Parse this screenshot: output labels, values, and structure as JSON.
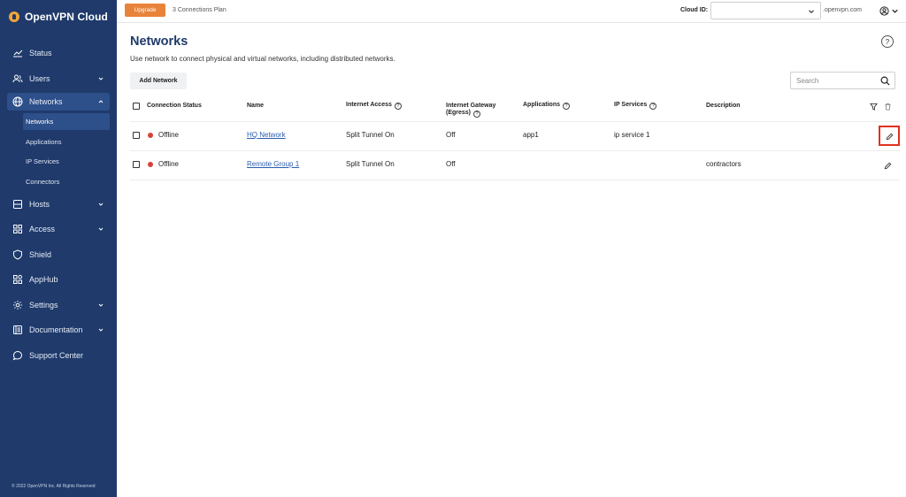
{
  "app": {
    "title": "OpenVPN Cloud",
    "copyright": "© 2022 OpenVPN Inc. All Rights Reserved"
  },
  "topbar": {
    "upgrade_label": "Upgrade",
    "plan_text": "3 Connections Plan",
    "cloud_id_label": "Cloud ID:",
    "cloud_id_value": "",
    "domain_suffix": ".openvpn.com"
  },
  "sidebar": {
    "items": [
      {
        "label": "Status",
        "icon": "chart-line-icon"
      },
      {
        "label": "Users",
        "icon": "users-icon"
      },
      {
        "label": "Networks",
        "icon": "globe-icon"
      },
      {
        "label": "Hosts",
        "icon": "server-icon"
      },
      {
        "label": "Access",
        "icon": "grid-icon"
      },
      {
        "label": "Shield",
        "icon": "shield-icon"
      },
      {
        "label": "AppHub",
        "icon": "apphub-icon"
      },
      {
        "label": "Settings",
        "icon": "gear-icon"
      },
      {
        "label": "Documentation",
        "icon": "book-icon"
      },
      {
        "label": "Support Center",
        "icon": "chat-icon"
      }
    ],
    "network_subitems": [
      "Networks",
      "Applications",
      "IP Services",
      "Connectors"
    ]
  },
  "main": {
    "title": "Networks",
    "description": "Use network to connect physical and virtual networks, including distributed networks.",
    "add_button": "Add Network",
    "search_placeholder": "Search"
  },
  "table": {
    "headers": {
      "status": "Connection Status",
      "name": "Name",
      "internet_access": "Internet Access",
      "gateway_1": "Internet Gateway",
      "gateway_2": "(Egress)",
      "applications": "Applications",
      "ip_services": "IP Services",
      "description": "Description"
    },
    "rows": [
      {
        "status": "Offline",
        "status_color": "#d9413a",
        "name": "HQ Network",
        "internet_access": "Split Tunnel On",
        "gateway": "Off",
        "applications": "app1",
        "ip_services": "ip service 1",
        "description": ""
      },
      {
        "status": "Offline",
        "status_color": "#d9413a",
        "name": "Remote Group 1",
        "internet_access": "Split Tunnel On",
        "gateway": "Off",
        "applications": "",
        "ip_services": "",
        "description": "contractors"
      }
    ]
  },
  "colors": {
    "sidebar_bg": "#1f3a6b",
    "accent": "#e8843a",
    "title": "#1f3a6b",
    "highlight": "#e0311f"
  }
}
